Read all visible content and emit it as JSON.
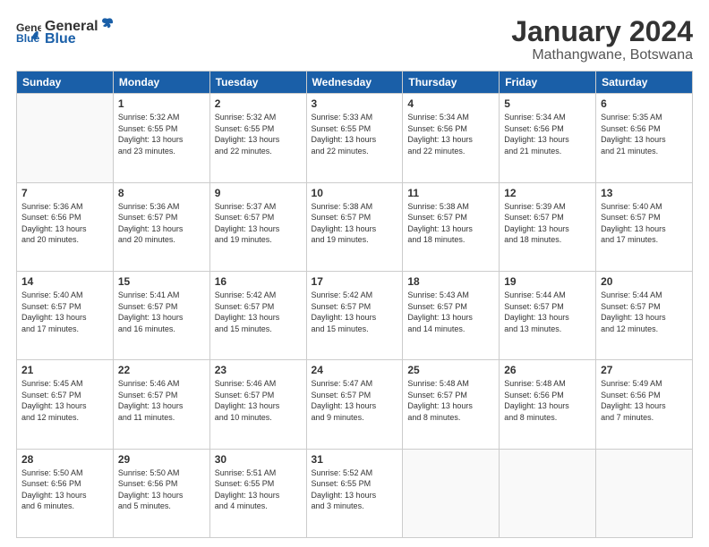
{
  "logo": {
    "general": "General",
    "blue": "Blue"
  },
  "title": "January 2024",
  "subtitle": "Mathangwane, Botswana",
  "headers": [
    "Sunday",
    "Monday",
    "Tuesday",
    "Wednesday",
    "Thursday",
    "Friday",
    "Saturday"
  ],
  "weeks": [
    [
      {
        "day": "",
        "info": ""
      },
      {
        "day": "1",
        "info": "Sunrise: 5:32 AM\nSunset: 6:55 PM\nDaylight: 13 hours\nand 23 minutes."
      },
      {
        "day": "2",
        "info": "Sunrise: 5:32 AM\nSunset: 6:55 PM\nDaylight: 13 hours\nand 22 minutes."
      },
      {
        "day": "3",
        "info": "Sunrise: 5:33 AM\nSunset: 6:55 PM\nDaylight: 13 hours\nand 22 minutes."
      },
      {
        "day": "4",
        "info": "Sunrise: 5:34 AM\nSunset: 6:56 PM\nDaylight: 13 hours\nand 22 minutes."
      },
      {
        "day": "5",
        "info": "Sunrise: 5:34 AM\nSunset: 6:56 PM\nDaylight: 13 hours\nand 21 minutes."
      },
      {
        "day": "6",
        "info": "Sunrise: 5:35 AM\nSunset: 6:56 PM\nDaylight: 13 hours\nand 21 minutes."
      }
    ],
    [
      {
        "day": "7",
        "info": "Sunrise: 5:36 AM\nSunset: 6:56 PM\nDaylight: 13 hours\nand 20 minutes."
      },
      {
        "day": "8",
        "info": "Sunrise: 5:36 AM\nSunset: 6:57 PM\nDaylight: 13 hours\nand 20 minutes."
      },
      {
        "day": "9",
        "info": "Sunrise: 5:37 AM\nSunset: 6:57 PM\nDaylight: 13 hours\nand 19 minutes."
      },
      {
        "day": "10",
        "info": "Sunrise: 5:38 AM\nSunset: 6:57 PM\nDaylight: 13 hours\nand 19 minutes."
      },
      {
        "day": "11",
        "info": "Sunrise: 5:38 AM\nSunset: 6:57 PM\nDaylight: 13 hours\nand 18 minutes."
      },
      {
        "day": "12",
        "info": "Sunrise: 5:39 AM\nSunset: 6:57 PM\nDaylight: 13 hours\nand 18 minutes."
      },
      {
        "day": "13",
        "info": "Sunrise: 5:40 AM\nSunset: 6:57 PM\nDaylight: 13 hours\nand 17 minutes."
      }
    ],
    [
      {
        "day": "14",
        "info": "Sunrise: 5:40 AM\nSunset: 6:57 PM\nDaylight: 13 hours\nand 17 minutes."
      },
      {
        "day": "15",
        "info": "Sunrise: 5:41 AM\nSunset: 6:57 PM\nDaylight: 13 hours\nand 16 minutes."
      },
      {
        "day": "16",
        "info": "Sunrise: 5:42 AM\nSunset: 6:57 PM\nDaylight: 13 hours\nand 15 minutes."
      },
      {
        "day": "17",
        "info": "Sunrise: 5:42 AM\nSunset: 6:57 PM\nDaylight: 13 hours\nand 15 minutes."
      },
      {
        "day": "18",
        "info": "Sunrise: 5:43 AM\nSunset: 6:57 PM\nDaylight: 13 hours\nand 14 minutes."
      },
      {
        "day": "19",
        "info": "Sunrise: 5:44 AM\nSunset: 6:57 PM\nDaylight: 13 hours\nand 13 minutes."
      },
      {
        "day": "20",
        "info": "Sunrise: 5:44 AM\nSunset: 6:57 PM\nDaylight: 13 hours\nand 12 minutes."
      }
    ],
    [
      {
        "day": "21",
        "info": "Sunrise: 5:45 AM\nSunset: 6:57 PM\nDaylight: 13 hours\nand 12 minutes."
      },
      {
        "day": "22",
        "info": "Sunrise: 5:46 AM\nSunset: 6:57 PM\nDaylight: 13 hours\nand 11 minutes."
      },
      {
        "day": "23",
        "info": "Sunrise: 5:46 AM\nSunset: 6:57 PM\nDaylight: 13 hours\nand 10 minutes."
      },
      {
        "day": "24",
        "info": "Sunrise: 5:47 AM\nSunset: 6:57 PM\nDaylight: 13 hours\nand 9 minutes."
      },
      {
        "day": "25",
        "info": "Sunrise: 5:48 AM\nSunset: 6:57 PM\nDaylight: 13 hours\nand 8 minutes."
      },
      {
        "day": "26",
        "info": "Sunrise: 5:48 AM\nSunset: 6:56 PM\nDaylight: 13 hours\nand 8 minutes."
      },
      {
        "day": "27",
        "info": "Sunrise: 5:49 AM\nSunset: 6:56 PM\nDaylight: 13 hours\nand 7 minutes."
      }
    ],
    [
      {
        "day": "28",
        "info": "Sunrise: 5:50 AM\nSunset: 6:56 PM\nDaylight: 13 hours\nand 6 minutes."
      },
      {
        "day": "29",
        "info": "Sunrise: 5:50 AM\nSunset: 6:56 PM\nDaylight: 13 hours\nand 5 minutes."
      },
      {
        "day": "30",
        "info": "Sunrise: 5:51 AM\nSunset: 6:55 PM\nDaylight: 13 hours\nand 4 minutes."
      },
      {
        "day": "31",
        "info": "Sunrise: 5:52 AM\nSunset: 6:55 PM\nDaylight: 13 hours\nand 3 minutes."
      },
      {
        "day": "",
        "info": ""
      },
      {
        "day": "",
        "info": ""
      },
      {
        "day": "",
        "info": ""
      }
    ]
  ]
}
